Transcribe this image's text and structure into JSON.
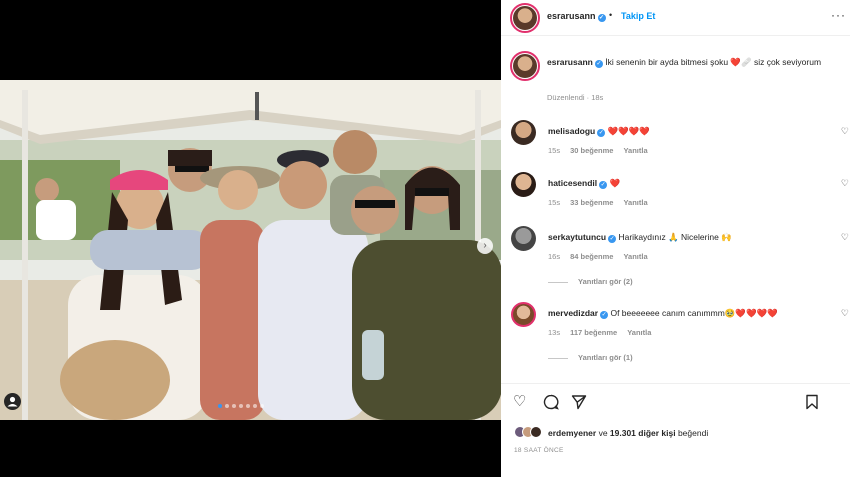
{
  "post": {
    "author": "esrarusann",
    "follow_label": "Takip Et",
    "dot": "•",
    "caption": "İki senenin bir ayda bitmesi şoku ❤️🩹 siz çok seviyorum",
    "edited": "Düzenlendi · 18s",
    "carousel": {
      "count": 7,
      "active_index": 0
    }
  },
  "comments": [
    {
      "user": "melisadogu",
      "verified": true,
      "text": "❤️❤️❤️❤️",
      "time": "15s",
      "likes": "30 beğenme",
      "reply_label": "Yanıtla",
      "replies": ""
    },
    {
      "user": "haticesendil",
      "verified": true,
      "text": "❤️",
      "time": "15s",
      "likes": "33 beğenme",
      "reply_label": "Yanıtla",
      "replies": ""
    },
    {
      "user": "serkaytutuncu",
      "verified": true,
      "text": "Harikaydınız 🙏 Nicelerine 🙌",
      "time": "16s",
      "likes": "84 beğenme",
      "reply_label": "Yanıtla",
      "replies": "Yanıtları gör (2)"
    },
    {
      "user": "mervedizdar",
      "verified": true,
      "text": "Of beeeeeee canım canımmm🥹❤️❤️❤️❤️",
      "time": "13s",
      "likes": "117 beğenme",
      "reply_label": "Yanıtla",
      "replies": "Yanıtları gör (1)"
    }
  ],
  "likes": {
    "first_user": "erdemyener",
    "connector": " ve ",
    "others": "19.301 diğer kişi",
    "suffix": " beğendi"
  },
  "time_ago": "18 SAAT ÖNCE",
  "icons": {
    "heart": "♡",
    "comment": "◯",
    "share": "➤",
    "save": "⚐",
    "more": "···",
    "next": "›"
  },
  "colors": {
    "accent": "#0095f6",
    "verified": "#3897f0",
    "heart_red": "#ed4956",
    "muted": "#8e8e8e"
  }
}
